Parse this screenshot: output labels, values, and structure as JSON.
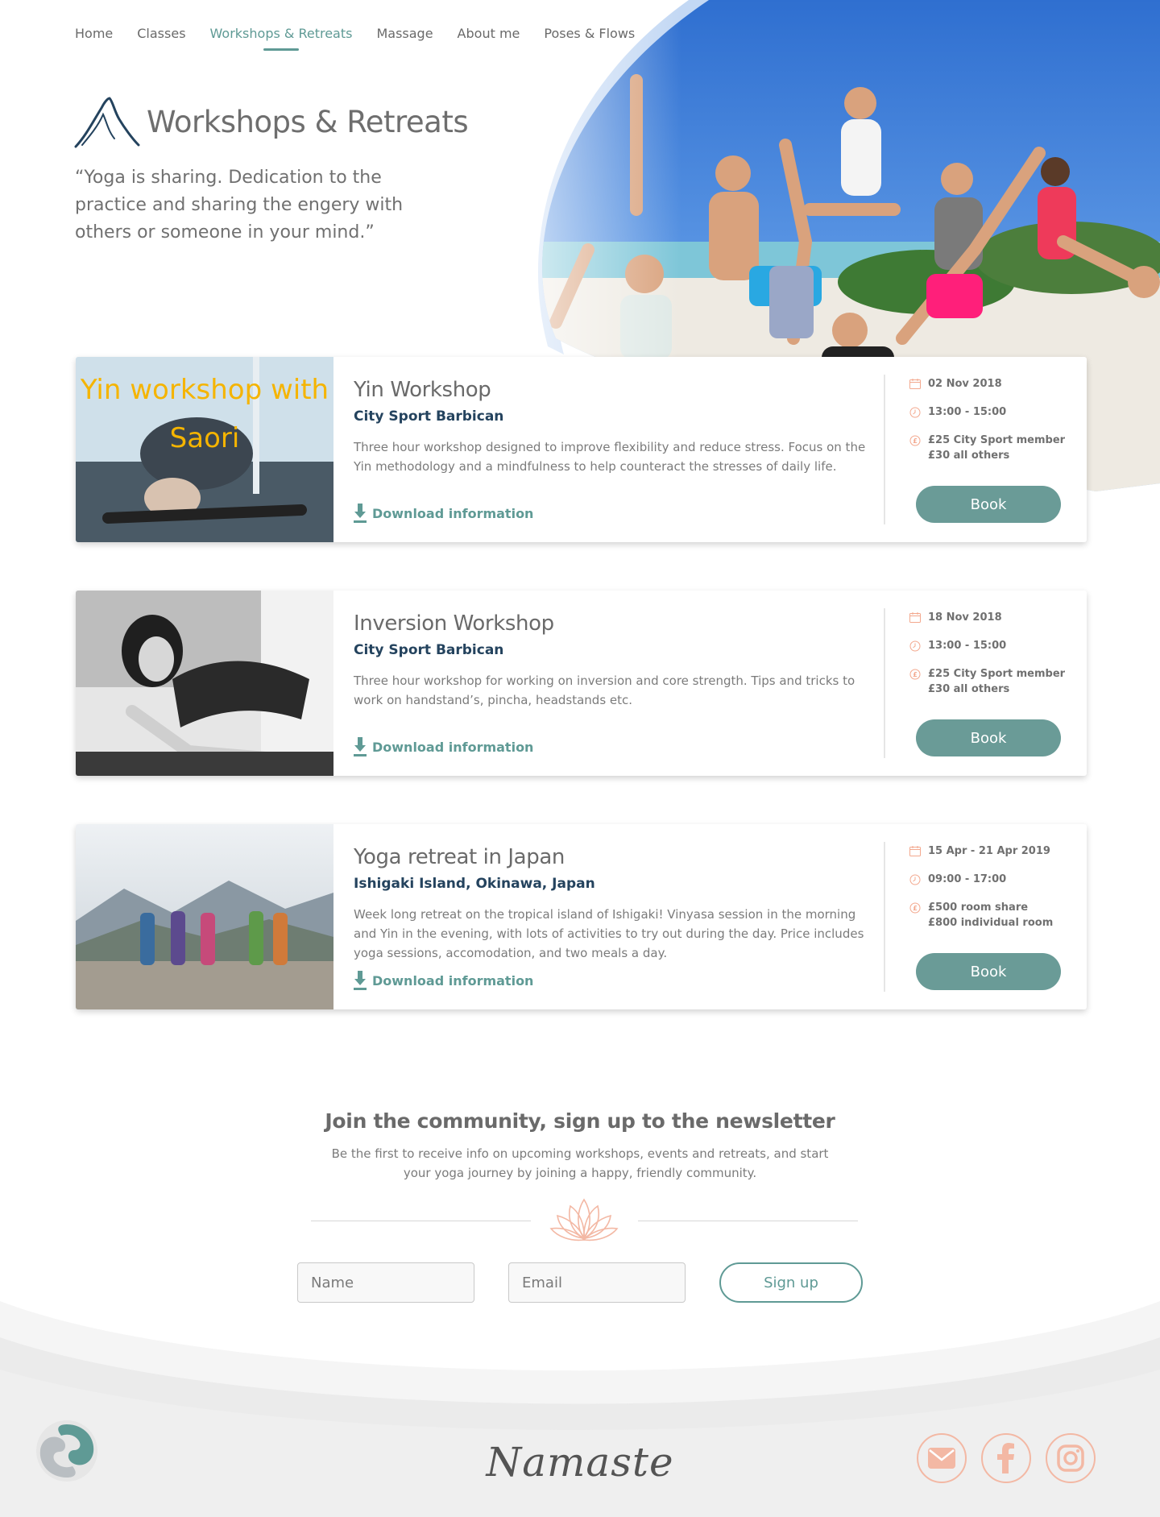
{
  "nav": {
    "items": [
      "Home",
      "Classes",
      "Workshops & Retreats",
      "Massage",
      "About me",
      "Poses & Flows"
    ],
    "active_index": 2
  },
  "hero": {
    "title": "Workshops & Retreats",
    "quote": "“Yoga is sharing. Dedication to the practice and sharing the engery with others or someone in your mind.”"
  },
  "cards": [
    {
      "image_caption": "Yin workshop with Saori",
      "title": "Yin Workshop",
      "venue": "City Sport Barbican",
      "description": "Three hour workshop designed to improve flexibility and reduce stress. Focus on the Yin methodology and a mindfulness to help counteract the stresses of daily life.",
      "download_label": "Download information",
      "date": "02 Nov 2018",
      "time": "13:00 - 15:00",
      "price_line1": "£25 City Sport member",
      "price_line2": "£30 all others",
      "book_label": "Book"
    },
    {
      "title": "Inversion Workshop",
      "venue": "City Sport Barbican",
      "description": "Three hour workshop for working on inversion and core strength. Tips and tricks to work on handstand’s, pincha, headstands etc.",
      "download_label": "Download information",
      "date": "18 Nov 2018",
      "time": "13:00 - 15:00",
      "price_line1": "£25 City Sport member",
      "price_line2": "£30 all others",
      "book_label": "Book"
    },
    {
      "title": "Yoga retreat in Japan",
      "venue": "Ishigaki Island, Okinawa, Japan",
      "description": "Week long retreat on the tropical island of Ishigaki! Vinyasa session in the morning and Yin in the evening, with lots of activities to try out during the day. Price includes yoga sessions, accomodation, and two meals a day.",
      "download_label": "Download information",
      "date": "15 Apr - 21 Apr 2019",
      "time": "09:00 - 17:00",
      "price_line1": "£500 room share",
      "price_line2": "£800 individual room",
      "book_label": "Book"
    }
  ],
  "newsletter": {
    "title": "Join the community, sign up to the newsletter",
    "text": "Be the first to receive info on upcoming workshops, events and retreats, and start your yoga journey by joining a happy, friendly community.",
    "name_placeholder": "Name",
    "email_placeholder": "Email",
    "signup_label": "Sign up"
  },
  "footer": {
    "namaste": "Namaste",
    "social": [
      "email-icon",
      "facebook-icon",
      "instagram-icon"
    ]
  },
  "colors": {
    "accent": "#5f9a95",
    "button": "#6a9b97",
    "venue": "#24435e",
    "coral": "#f3b8a4",
    "caption_yellow": "#f5b400"
  }
}
